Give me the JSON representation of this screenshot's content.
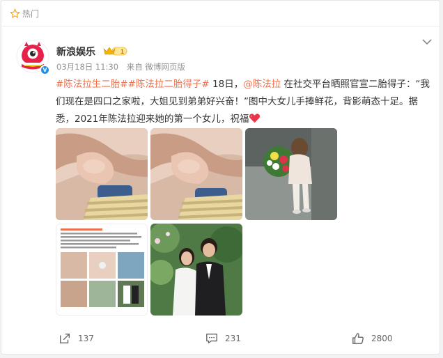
{
  "hot_bar": {
    "label": "热门",
    "icon": "star-icon"
  },
  "post": {
    "author": "新浪娱乐",
    "avatar_icon": "sina-avatar-icon",
    "verified_icon": "verified-v-icon",
    "member_badge_icon": "crown-level-badge-icon",
    "member_badge_text": "1",
    "date": "03月18日 11:30",
    "source": "来自 微博网页版",
    "text": {
      "tag1": "#陈法拉生二胎#",
      "tag2": "#陈法拉二胎得子#",
      "part1": " 18日，",
      "mention": "@陈法拉",
      "part2": " 在社交平台晒照官宣二胎得子：“我们现在是四口之家啦，大姐见到弟弟好兴奋！”图中大女儿手捧鲜花，背影萌态十足。据悉，2021年陈法拉迎来她的第一个女儿，祝福",
      "emoji": "heart-icon"
    },
    "photos": [
      "baby-hand-photo-1",
      "baby-hand-photo-2",
      "girl-with-flowers-photo",
      "screenshot-collage-photo",
      "couple-wedding-photo"
    ]
  },
  "actions": {
    "share": {
      "icon": "share-icon",
      "count": "137"
    },
    "comment": {
      "icon": "comment-icon",
      "count": "231"
    },
    "like": {
      "icon": "like-icon",
      "count": "2800"
    }
  },
  "colors": {
    "accent": "#eb7350",
    "meta": "#939393",
    "verified": "#1d8ff0"
  }
}
